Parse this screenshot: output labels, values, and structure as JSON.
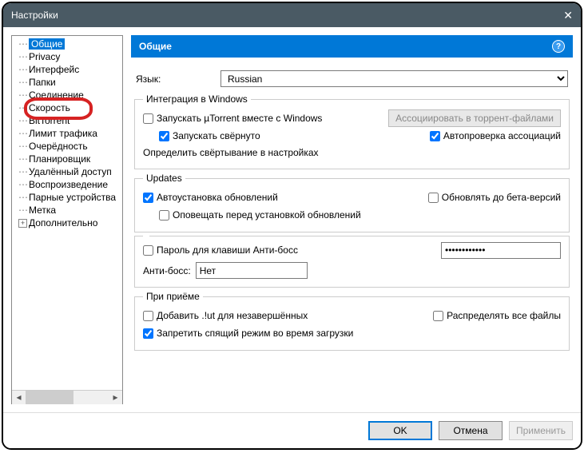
{
  "window": {
    "title": "Настройки"
  },
  "sidebar": {
    "items": [
      {
        "label": "Общие",
        "selected": true
      },
      {
        "label": "Privacy"
      },
      {
        "label": "Интерфейс"
      },
      {
        "label": "Папки",
        "highlighted": true
      },
      {
        "label": "Соединение"
      },
      {
        "label": "Скорость"
      },
      {
        "label": "BitTorrent"
      },
      {
        "label": "Лимит трафика"
      },
      {
        "label": "Очерёдность"
      },
      {
        "label": "Планировщик"
      },
      {
        "label": "Удалённый доступ"
      },
      {
        "label": "Воспроизведение"
      },
      {
        "label": "Парные устройства"
      },
      {
        "label": "Метка"
      },
      {
        "label": "Дополнительно",
        "expandable": true
      }
    ]
  },
  "main": {
    "header": "Общие",
    "language_label": "Язык:",
    "language_value": "Russian",
    "group_windows": {
      "legend": "Интеграция в Windows",
      "start_with_windows": "Запускать µTorrent вместе с Windows",
      "assoc_btn": "Ассоциировать в торрент-файлами",
      "start_minimized": "Запускать свёрнуто",
      "auto_check": "Автопроверка ассоциаций",
      "explain": "Определить свёртывание в настройках"
    },
    "group_updates": {
      "legend": "Updates",
      "auto_install": "Автоустановка обновлений",
      "beta": "Обновлять до бета-версий",
      "notify": "Оповещать перед установкой обновлений"
    },
    "group_boss": {
      "pass_label": "Пароль для клавиши Анти-босс",
      "pass_value": "••••••••••••",
      "antiboss_label": "Анти-босс:",
      "antiboss_value": "Нет"
    },
    "group_receive": {
      "legend": "При приёме",
      "add_ut": "Добавить .!ut для незавершённых",
      "distribute": "Распределять все файлы",
      "prevent_sleep": "Запретить спящий режим во время загрузки"
    }
  },
  "footer": {
    "ok": "OK",
    "cancel": "Отмена",
    "apply": "Применить"
  }
}
